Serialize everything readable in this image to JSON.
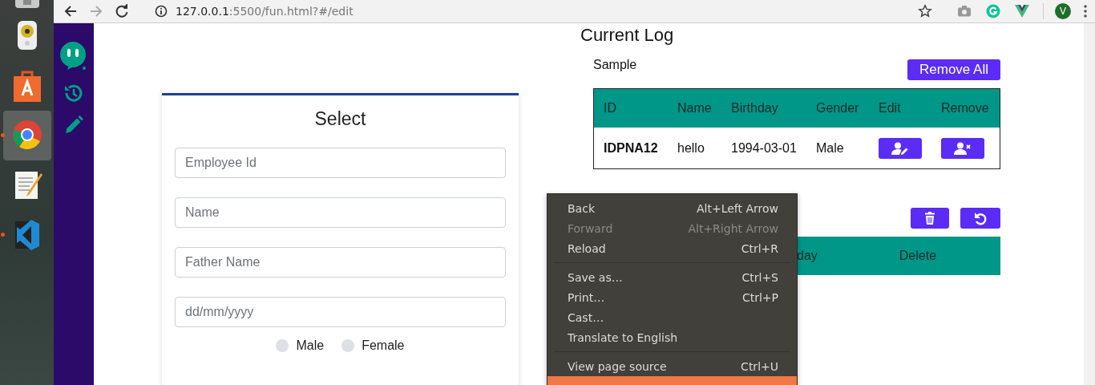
{
  "dock": {
    "items": [
      {
        "kind": "drive",
        "selected": false,
        "running": false
      },
      {
        "kind": "speaker",
        "selected": false,
        "running": false
      },
      {
        "kind": "store",
        "selected": false,
        "running": false
      },
      {
        "kind": "browser",
        "selected": true,
        "running": true
      },
      {
        "kind": "notepad",
        "selected": false,
        "running": false
      },
      {
        "kind": "code",
        "selected": false,
        "running": true
      }
    ]
  },
  "toolbar": {
    "back_disabled": false,
    "forward_disabled": true,
    "url": {
      "host": "127.0.0.1",
      "path": ":5500/fun.html?#/edit"
    },
    "avatar": "V"
  },
  "sidebar": {
    "items": [
      {
        "kind": "chat"
      },
      {
        "kind": "history"
      },
      {
        "kind": "edit"
      }
    ]
  },
  "form": {
    "title": "Select",
    "fields": [
      {
        "placeholder": "Employee Id"
      },
      {
        "placeholder": "Name"
      },
      {
        "placeholder": "Father Name"
      },
      {
        "placeholder": "dd/mm/yyyy"
      }
    ],
    "gender": [
      {
        "label": "Male",
        "selected": false
      },
      {
        "label": "Female",
        "selected": false
      }
    ]
  },
  "log": {
    "title": "Current Log",
    "subtitle": "Sample",
    "remove_all": "Remove All",
    "table": {
      "columns": [
        "ID",
        "Name",
        "Birthday",
        "Gender",
        "Edit",
        "Remove"
      ],
      "rows": [
        {
          "id": "IDPNA12",
          "name": "hello",
          "birthday": "1994-03-01",
          "gender": "Male"
        }
      ]
    }
  },
  "history": {
    "actions": [
      {
        "kind": "delete"
      },
      {
        "kind": "undo"
      }
    ],
    "columns": [
      "day",
      "Delete"
    ]
  },
  "context_menu": {
    "groups": [
      [
        {
          "label": "Back",
          "shortcut": "Alt+Left Arrow",
          "disabled": false,
          "highlighted": false
        },
        {
          "label": "Forward",
          "shortcut": "Alt+Right Arrow",
          "disabled": true,
          "highlighted": false
        },
        {
          "label": "Reload",
          "shortcut": "Ctrl+R",
          "disabled": false,
          "highlighted": false
        }
      ],
      [
        {
          "label": "Save as…",
          "shortcut": "Ctrl+S",
          "disabled": false,
          "highlighted": false
        },
        {
          "label": "Print…",
          "shortcut": "Ctrl+P",
          "disabled": false,
          "highlighted": false
        },
        {
          "label": "Cast…",
          "disabled": false,
          "highlighted": false
        },
        {
          "label": "Translate to English",
          "disabled": false,
          "highlighted": false
        }
      ],
      [
        {
          "label": "View page source",
          "shortcut": "Ctrl+U",
          "disabled": false,
          "highlighted": false
        },
        {
          "disabled": false,
          "highlighted": true
        }
      ]
    ]
  }
}
